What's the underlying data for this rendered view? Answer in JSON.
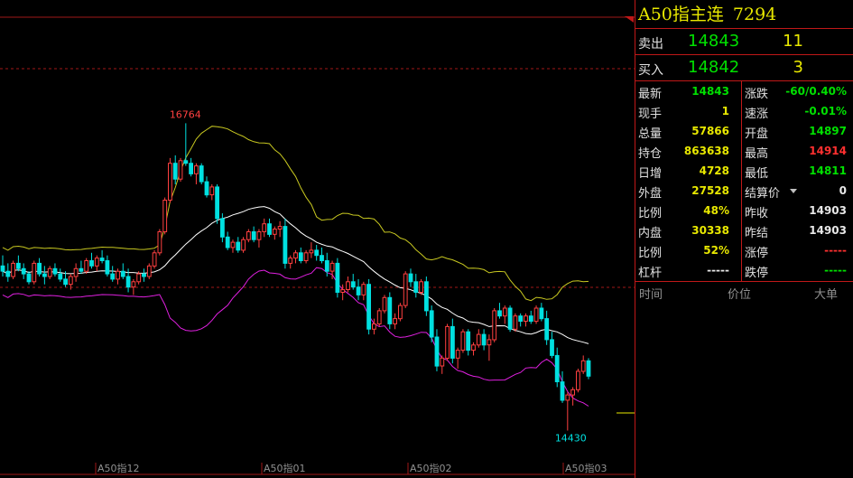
{
  "instrument": {
    "name": "A50指主连",
    "code": "7294"
  },
  "quote": {
    "ask": {
      "label": "卖出",
      "price": "14843",
      "volume": "11"
    },
    "bid": {
      "label": "买入",
      "price": "14842",
      "volume": "3"
    },
    "rows": [
      {
        "l": "最新",
        "v": "14843",
        "vc": "g",
        "l2": "涨跌",
        "v2": "-60/0.40%",
        "v2c": "g"
      },
      {
        "l": "现手",
        "v": "1",
        "vc": "y",
        "l2": "速涨",
        "v2": "-0.01%",
        "v2c": "g"
      },
      {
        "l": "总量",
        "v": "57866",
        "vc": "y",
        "l2": "开盘",
        "v2": "14897",
        "v2c": "g"
      },
      {
        "l": "持仓",
        "v": "863638",
        "vc": "y",
        "l2": "最高",
        "v2": "14914",
        "v2c": "r"
      },
      {
        "l": "日增",
        "v": "4728",
        "vc": "y",
        "l2": "最低",
        "v2": "14811",
        "v2c": "g"
      },
      {
        "l": "外盘",
        "v": "27528",
        "vc": "y",
        "l2": "结算价",
        "v2": "0",
        "v2c": "w"
      },
      {
        "l": "比例",
        "v": "48%",
        "vc": "y",
        "l2": "昨收",
        "v2": "14903",
        "v2c": "w"
      },
      {
        "l": "内盘",
        "v": "30338",
        "vc": "y",
        "l2": "昨结",
        "v2": "14903",
        "v2c": "w"
      },
      {
        "l": "比例",
        "v": "52%",
        "vc": "y",
        "l2": "涨停",
        "v2": "-----",
        "v2c": "r"
      },
      {
        "l": "杠杆",
        "v": "-----",
        "vc": "w",
        "l2": "跌停",
        "v2": "-----",
        "v2c": "g"
      }
    ]
  },
  "ticks_header": {
    "time": "时间",
    "price": "价位",
    "big": "大单"
  },
  "chart_data": {
    "type": "candlestick",
    "high_label": "16764",
    "low_label": "14430",
    "x_labels": [
      "A50指12",
      "A50指01",
      "A50指02",
      "A50指03"
    ],
    "colors": {
      "up": "#ff4040",
      "down": "#00e0e0",
      "mid": "#ffffff",
      "upper": "#c8c820",
      "lower": "#e020e0",
      "grid": "#a01818"
    },
    "candles": [
      [
        15680,
        15760,
        15600,
        15640
      ],
      [
        15640,
        15700,
        15560,
        15600
      ],
      [
        15600,
        15720,
        15580,
        15700
      ],
      [
        15700,
        15760,
        15640,
        15660
      ],
      [
        15660,
        15700,
        15580,
        15620
      ],
      [
        15620,
        15640,
        15540,
        15560
      ],
      [
        15560,
        15720,
        15540,
        15700
      ],
      [
        15700,
        15740,
        15600,
        15620
      ],
      [
        15620,
        15680,
        15540,
        15600
      ],
      [
        15600,
        15680,
        15580,
        15660
      ],
      [
        15660,
        15700,
        15600,
        15620
      ],
      [
        15620,
        15660,
        15560,
        15580
      ],
      [
        15580,
        15640,
        15520,
        15540
      ],
      [
        15540,
        15620,
        15500,
        15600
      ],
      [
        15600,
        15700,
        15560,
        15660
      ],
      [
        15660,
        15720,
        15620,
        15640
      ],
      [
        15640,
        15740,
        15620,
        15720
      ],
      [
        15720,
        15780,
        15660,
        15680
      ],
      [
        15680,
        15760,
        15640,
        15740
      ],
      [
        15740,
        15800,
        15700,
        15720
      ],
      [
        15720,
        15760,
        15600,
        15620
      ],
      [
        15620,
        15680,
        15560,
        15580
      ],
      [
        15580,
        15660,
        15540,
        15640
      ],
      [
        15640,
        15700,
        15580,
        15600
      ],
      [
        15600,
        15660,
        15480,
        15520
      ],
      [
        15520,
        15580,
        15460,
        15560
      ],
      [
        15560,
        15640,
        15540,
        15620
      ],
      [
        15620,
        15660,
        15560,
        15600
      ],
      [
        15600,
        15700,
        15580,
        15680
      ],
      [
        15680,
        15800,
        15660,
        15780
      ],
      [
        15780,
        15960,
        15760,
        15940
      ],
      [
        15940,
        16200,
        15920,
        16180
      ],
      [
        16180,
        16500,
        16160,
        16460
      ],
      [
        16460,
        16520,
        16300,
        16340
      ],
      [
        16340,
        16500,
        16320,
        16480
      ],
      [
        16480,
        16764,
        16440,
        16460
      ],
      [
        16460,
        16500,
        16360,
        16380
      ],
      [
        16380,
        16460,
        16300,
        16440
      ],
      [
        16440,
        16460,
        16300,
        16320
      ],
      [
        16320,
        16360,
        16200,
        16220
      ],
      [
        16220,
        16300,
        16180,
        16280
      ],
      [
        16280,
        16300,
        16000,
        16040
      ],
      [
        16040,
        16080,
        15860,
        15900
      ],
      [
        15900,
        15940,
        15800,
        15820
      ],
      [
        15820,
        15880,
        15780,
        15860
      ],
      [
        15860,
        15900,
        15780,
        15800
      ],
      [
        15800,
        15900,
        15780,
        15880
      ],
      [
        15880,
        15960,
        15860,
        15940
      ],
      [
        15940,
        15980,
        15860,
        15880
      ],
      [
        15880,
        15960,
        15820,
        15940
      ],
      [
        15940,
        16040,
        15900,
        16000
      ],
      [
        16000,
        16040,
        15900,
        15920
      ],
      [
        15920,
        15980,
        15880,
        15960
      ],
      [
        15960,
        16020,
        15900,
        15980
      ],
      [
        15980,
        16040,
        15660,
        15700
      ],
      [
        15700,
        15760,
        15660,
        15740
      ],
      [
        15740,
        15800,
        15700,
        15780
      ],
      [
        15780,
        15820,
        15700,
        15720
      ],
      [
        15720,
        15800,
        15700,
        15780
      ],
      [
        15780,
        15860,
        15740,
        15800
      ],
      [
        15800,
        15840,
        15720,
        15760
      ],
      [
        15760,
        15820,
        15700,
        15720
      ],
      [
        15720,
        15780,
        15600,
        15640
      ],
      [
        15640,
        15720,
        15580,
        15700
      ],
      [
        15700,
        15740,
        15440,
        15480
      ],
      [
        15480,
        15540,
        15420,
        15500
      ],
      [
        15500,
        15600,
        15480,
        15560
      ],
      [
        15560,
        15620,
        15500,
        15520
      ],
      [
        15520,
        15580,
        15420,
        15460
      ],
      [
        15460,
        15560,
        15420,
        15540
      ],
      [
        15540,
        15580,
        15160,
        15200
      ],
      [
        15200,
        15280,
        15160,
        15240
      ],
      [
        15240,
        15360,
        15220,
        15340
      ],
      [
        15340,
        15460,
        15320,
        15440
      ],
      [
        15440,
        15480,
        15200,
        15240
      ],
      [
        15240,
        15320,
        15200,
        15280
      ],
      [
        15280,
        15400,
        15260,
        15380
      ],
      [
        15380,
        15640,
        15360,
        15620
      ],
      [
        15620,
        15660,
        15520,
        15560
      ],
      [
        15560,
        15620,
        15440,
        15480
      ],
      [
        15480,
        15580,
        15460,
        15560
      ],
      [
        15560,
        15600,
        15300,
        15340
      ],
      [
        15340,
        15380,
        15100,
        15140
      ],
      [
        15140,
        15200,
        14880,
        14920
      ],
      [
        14920,
        15000,
        14860,
        14980
      ],
      [
        14980,
        15240,
        14960,
        15220
      ],
      [
        15220,
        15280,
        14940,
        14980
      ],
      [
        14980,
        15060,
        14900,
        15040
      ],
      [
        15040,
        15200,
        15020,
        15180
      ],
      [
        15180,
        15200,
        15000,
        15040
      ],
      [
        15040,
        15100,
        15000,
        15080
      ],
      [
        15080,
        15200,
        15060,
        15160
      ],
      [
        15160,
        15200,
        15040,
        15080
      ],
      [
        15080,
        15160,
        14960,
        15120
      ],
      [
        15120,
        15360,
        15100,
        15340
      ],
      [
        15340,
        15400,
        15280,
        15300
      ],
      [
        15300,
        15380,
        15240,
        15360
      ],
      [
        15360,
        15380,
        15180,
        15200
      ],
      [
        15200,
        15320,
        15180,
        15300
      ],
      [
        15300,
        15320,
        15220,
        15260
      ],
      [
        15260,
        15320,
        15220,
        15300
      ],
      [
        15300,
        15340,
        15240,
        15260
      ],
      [
        15260,
        15380,
        15240,
        15360
      ],
      [
        15360,
        15400,
        15260,
        15280
      ],
      [
        15280,
        15340,
        15080,
        15120
      ],
      [
        15120,
        15180,
        14980,
        15000
      ],
      [
        15000,
        15060,
        14760,
        14800
      ],
      [
        14800,
        14880,
        14640,
        14660
      ],
      [
        14660,
        14720,
        14430,
        14700
      ],
      [
        14700,
        14760,
        14620,
        14740
      ],
      [
        14740,
        14900,
        14720,
        14880
      ],
      [
        14880,
        15000,
        14860,
        14960
      ],
      [
        14960,
        14980,
        14820,
        14843
      ]
    ]
  }
}
